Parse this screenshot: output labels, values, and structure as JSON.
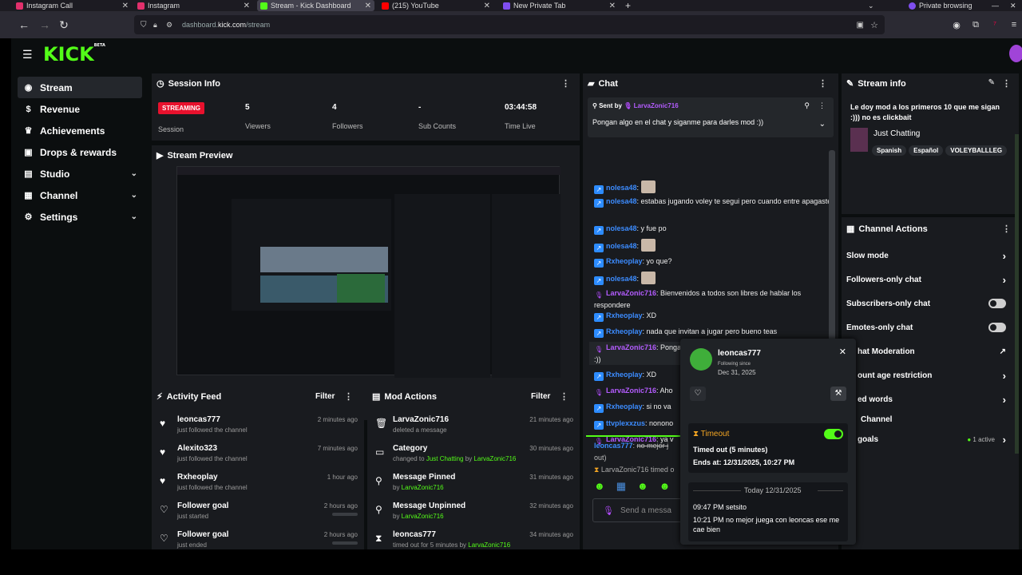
{
  "browser": {
    "tabs": [
      {
        "title": "Instagram Call",
        "color": "#e1306c"
      },
      {
        "title": "Instagram",
        "color": "#e1306c"
      },
      {
        "title": "Stream - Kick Dashboard",
        "color": "#53fc18"
      },
      {
        "title": "(215) YouTube",
        "color": "#ff0000"
      },
      {
        "title": "New Private Tab",
        "color": "#7f4ef0"
      }
    ],
    "private_label": "Private browsing",
    "url_host_prefix": "dashboard.",
    "url_host": "kick.com",
    "url_path": "/stream"
  },
  "app": {
    "logo": "KICK",
    "beta": "BETA"
  },
  "sidebar": {
    "items": [
      {
        "label": "Stream",
        "icon": "broadcast-icon",
        "selected": true
      },
      {
        "label": "Revenue",
        "icon": "dollar-icon"
      },
      {
        "label": "Achievements",
        "icon": "trophy-icon"
      },
      {
        "label": "Drops & rewards",
        "icon": "gift-icon"
      },
      {
        "label": "Studio",
        "icon": "studio-icon",
        "expandable": true
      },
      {
        "label": "Channel",
        "icon": "channel-icon",
        "expandable": true
      },
      {
        "label": "Settings",
        "icon": "gear-icon",
        "expandable": true
      }
    ]
  },
  "session": {
    "title": "Session Info",
    "status": "STREAMING",
    "status_label": "Session",
    "viewers": "5",
    "viewers_label": "Viewers",
    "followers": "4",
    "followers_label": "Followers",
    "subs": "-",
    "subs_label": "Sub Counts",
    "time": "03:44:58",
    "time_label": "Time Live"
  },
  "preview": {
    "title": "Stream Preview"
  },
  "activity": {
    "title": "Activity Feed",
    "filter": "Filter",
    "items": [
      {
        "name": "leoncas777",
        "sub": "just followed the channel",
        "time": "2 minutes ago"
      },
      {
        "name": "Alexito323",
        "sub": "just followed the channel",
        "time": "7 minutes ago"
      },
      {
        "name": "Rxheoplay",
        "sub": "just followed the channel",
        "time": "1 hour ago"
      },
      {
        "name": "Follower goal",
        "sub": "just started",
        "time": "2 hours ago"
      },
      {
        "name": "Follower goal",
        "sub": "just ended",
        "time": "2 hours ago"
      }
    ]
  },
  "modactions": {
    "title": "Mod Actions",
    "filter": "Filter",
    "items": [
      {
        "name": "LarvaZonic716",
        "sub_pre": "deleted a message",
        "time": "21 minutes ago"
      },
      {
        "name": "Category",
        "sub_pre": "changed to ",
        "sub_hl1": "Just Chatting",
        "sub_mid": " by ",
        "sub_hl2": "LarvaZonic716",
        "time": "30 minutes ago"
      },
      {
        "name": "Message Pinned",
        "sub_pre": "by ",
        "sub_hl1": "LarvaZonic716",
        "time": "31 minutes ago"
      },
      {
        "name": "Message Unpinned",
        "sub_pre": "by ",
        "sub_hl1": "LarvaZonic716",
        "time": "32 minutes ago"
      },
      {
        "name": "leoncas777",
        "sub_pre": "timed out for 5 minutes by ",
        "sub_hl1": "LarvaZonic716",
        "time": "34 minutes ago"
      }
    ]
  },
  "chat": {
    "title": "Chat",
    "pinned_label": "Sent by",
    "pinned_user": "LarvaZonic716",
    "pinned_text": "Pongan algo en el chat y siganme para darles mod :))",
    "messages": [
      {
        "user": "nolesa48",
        "badge": "blue",
        "text": ""
      },
      {
        "user": "nolesa48",
        "badge": "blue",
        "text": "estabas jugando voley te segui pero cuando entre apagaste"
      },
      {
        "user": "nolesa48",
        "badge": "blue",
        "text": "y fue po"
      },
      {
        "user": "nolesa48",
        "badge": "blue",
        "text": ""
      },
      {
        "user": "Rxheoplay",
        "badge": "blue",
        "text": "yo que?"
      },
      {
        "user": "nolesa48",
        "badge": "blue",
        "text": ""
      },
      {
        "user": "LarvaZonic716",
        "badge": "mic",
        "text": "Bienvenidos a todos son libres de hablar los respondere"
      },
      {
        "user": "Rxheoplay",
        "badge": "blue",
        "text": "XD"
      },
      {
        "user": "Rxheoplay",
        "badge": "blue",
        "text": "nada que invitan a jugar pero bueno teas"
      },
      {
        "user": "LarvaZonic716",
        "badge": "mic",
        "text": "Pongan algo en el chat y siganme para darles mod :))"
      },
      {
        "user": "Rxheoplay",
        "badge": "blue",
        "text": "XD"
      },
      {
        "user": "LarvaZonic716",
        "badge": "mic",
        "text": "Aho"
      },
      {
        "user": "Rxheoplay",
        "badge": "blue",
        "text": "si no va"
      },
      {
        "user": "ttvplexxzus",
        "badge": "blue",
        "text": "nonono"
      },
      {
        "user": "LarvaZonic716",
        "badge": "mic",
        "text": "ya v"
      }
    ],
    "deleted_user": "leoncas777",
    "deleted_text": "no mejor j",
    "deleted_tail": "out)",
    "timeout_line": "LarvaZonic716 timed o",
    "send_placeholder": "Send a messa"
  },
  "streaminfo": {
    "title": "Stream info",
    "stream_title": "Le doy mod a los primeros 10 que me sigan :))) no es clickbait",
    "category": "Just Chatting",
    "tags": [
      "Spanish",
      "Español",
      "VOLEYBALLLEG"
    ]
  },
  "channel_actions": {
    "title": "Channel Actions",
    "items": [
      {
        "label": "Slow mode",
        "kind": "chev"
      },
      {
        "label": "Followers-only chat",
        "kind": "chev"
      },
      {
        "label": "Subscribers-only chat",
        "kind": "toggle"
      },
      {
        "label": "Emotes-only chat",
        "kind": "toggle"
      },
      {
        "label": "hat Moderation",
        "kind": "ext"
      },
      {
        "label": "ount age restriction",
        "kind": "chev"
      },
      {
        "label": "ed words",
        "kind": "chev"
      },
      {
        "label": "Channel",
        "kind": "none"
      },
      {
        "label": "goals",
        "kind": "active"
      }
    ],
    "active_label": "1 active"
  },
  "usercard": {
    "username": "leoncas777",
    "following_label": "Following since",
    "following_date": "Dec 31, 2025",
    "timeout_title": "Timeout",
    "timeout_desc": "Timed out (5 minutes)",
    "timeout_ends": "Ends at: 12/31/2025, 10:27 PM",
    "day_divider": "Today 12/31/2025",
    "history": [
      {
        "time": "09:47 PM",
        "text": "setsito"
      },
      {
        "time": "10:21 PM",
        "text": "no mejor juega con leoncas ese me cae bien"
      }
    ]
  }
}
